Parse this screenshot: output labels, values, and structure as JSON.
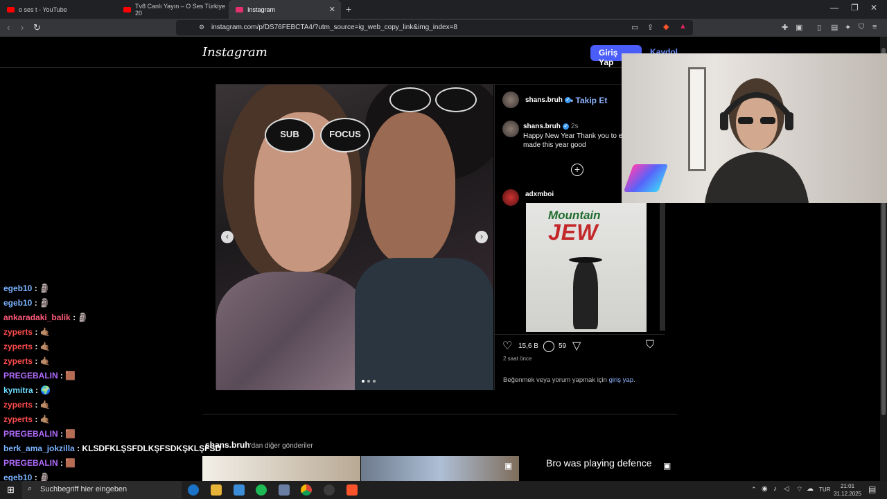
{
  "browser": {
    "tabs": [
      {
        "title": "o ses t - YouTube",
        "favicon_color": "#ff0000"
      },
      {
        "title": "Tv8 Canlı Yayın – O Ses Türkiye 20",
        "favicon_color": "#ff0000"
      },
      {
        "title": "Instagram",
        "favicon_color": "#e1306c"
      }
    ],
    "new_tab": "+",
    "url": "instagram.com/p/DS76FEBCTA4/?utm_source=ig_web_copy_link&img_index=8"
  },
  "header": {
    "logo": "Instagram",
    "login": "Giriş Yap",
    "signup": "Kaydol"
  },
  "post": {
    "author": "shans.bruh",
    "follow": "• Takip Et",
    "caption_author": "shans.bruh",
    "caption_time": "2s",
    "caption": "Happy New Year Thank you to e who has made this year good",
    "comment_author": "adxmboi",
    "meme_line1": "Mountain",
    "meme_line2": "JEW",
    "glasses_left": "SUB",
    "glasses_right": "FOCUS",
    "likes": "15,6 B",
    "comments": "59",
    "time_ago": "2 saat önce",
    "login_prompt": "Beğenmek veya yorum yapmak için",
    "login_link": "giriş yap",
    "login_suffix": "."
  },
  "more": {
    "author": "shans.bruh",
    "suffix": "'dan diğer gönderiler",
    "thumb_text": "Bro was playing defence"
  },
  "chat": [
    {
      "user": "egeb10",
      "color": "#7ab3ff",
      "msg": ": 🗿"
    },
    {
      "user": "egeb10",
      "color": "#7ab3ff",
      "msg": ": 🗿"
    },
    {
      "user": "ankaradaki_balik",
      "color": "#ff5a7a",
      "msg": ": 🗿"
    },
    {
      "user": "zyperts",
      "color": "#ff4b4b",
      "msg": ": 🤙🏽"
    },
    {
      "user": "zyperts",
      "color": "#ff4b4b",
      "msg": ": 🤙🏽"
    },
    {
      "user": "zyperts",
      "color": "#ff4b4b",
      "msg": ": 🤙🏽"
    },
    {
      "user": "PREGEBALIN",
      "color": "#b36bff",
      "msg": ": 🟫"
    },
    {
      "user": "kymitra",
      "color": "#6bdcff",
      "msg": ": 🌍"
    },
    {
      "user": "zyperts",
      "color": "#ff4b4b",
      "msg": ": 🤙🏽"
    },
    {
      "user": "zyperts",
      "color": "#ff4b4b",
      "msg": ": 🤙🏽"
    },
    {
      "user": "PREGEBALIN",
      "color": "#b36bff",
      "msg": ": 🟫"
    },
    {
      "user": "berk_ama_jokzilla",
      "color": "#7ab3ff",
      "msg": ": KLSDFKLŞSFDLKŞFSDKŞKLŞFSD"
    },
    {
      "user": "PREGEBALIN",
      "color": "#b36bff",
      "msg": ": 🟫"
    },
    {
      "user": "egeb10",
      "color": "#7ab3ff",
      "msg": ": 🗿"
    }
  ],
  "taskbar": {
    "search_placeholder": "Suchbegriff hier eingeben",
    "language": "TUR",
    "time": "21:01",
    "date": "31.12.2025"
  }
}
